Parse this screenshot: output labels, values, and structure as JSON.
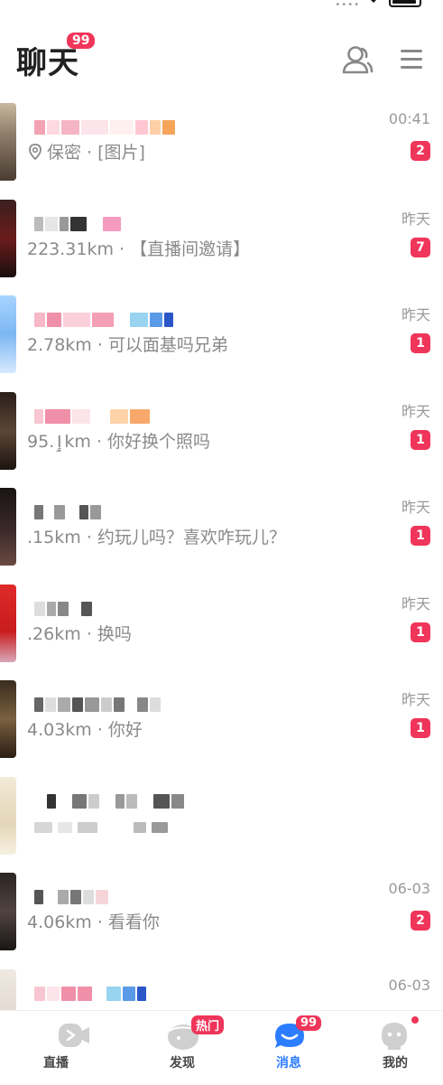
{
  "header": {
    "title": "聊天",
    "badge": "99",
    "icons": [
      "contacts-icon",
      "menu-icon"
    ]
  },
  "colors": {
    "badge": "#f0355a",
    "active_nav": "#2c7dff",
    "secondary_text": "#8a8a8a"
  },
  "chats": [
    {
      "preview_prefix": "",
      "preview": "保密 · [图片]",
      "time": "00:41",
      "unread": "2",
      "has_pin": true
    },
    {
      "preview_prefix": "",
      "preview": "223.31km · 【直播间邀请】",
      "time": "昨天",
      "unread": "7",
      "has_pin": false
    },
    {
      "preview_prefix": "",
      "preview": "2.78km · 可以面基吗兄弟",
      "time": "昨天",
      "unread": "1",
      "has_pin": false
    },
    {
      "preview_prefix": "",
      "preview": "ٳ.95km · 你好换个照吗",
      "time": "昨天",
      "unread": "1",
      "has_pin": false
    },
    {
      "preview_prefix": "",
      "preview": ".15km · 约玩儿吗？喜欢咋玩儿？",
      "time": "昨天",
      "unread": "1",
      "has_pin": false
    },
    {
      "preview_prefix": "",
      "preview": ".26km · 换吗",
      "time": "昨天",
      "unread": "1",
      "has_pin": false
    },
    {
      "preview_prefix": "",
      "preview": "4.03km · 你好",
      "time": "昨天",
      "unread": "1",
      "has_pin": false
    },
    {
      "preview_prefix": "",
      "preview": "",
      "time": "",
      "unread": "",
      "has_pin": false
    },
    {
      "preview_prefix": "",
      "preview": "4.06km · 看看你",
      "time": "06-03",
      "unread": "2",
      "has_pin": false
    },
    {
      "preview_prefix": "",
      "preview": "",
      "time": "06-03",
      "unread": "",
      "has_pin": false
    }
  ],
  "bottom_nav": [
    {
      "label": "直播",
      "icon": "live-icon",
      "badge": "",
      "active": false
    },
    {
      "label": "发现",
      "icon": "discover-icon",
      "badge": "热门",
      "active": false
    },
    {
      "label": "消息",
      "icon": "message-icon",
      "badge": "99",
      "active": true
    },
    {
      "label": "我的",
      "icon": "profile-icon",
      "badge": "",
      "active": false,
      "dot": true
    }
  ]
}
